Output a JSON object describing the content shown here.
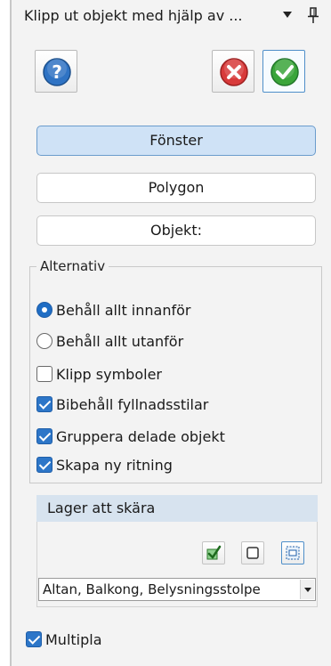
{
  "window": {
    "title": "Klipp ut objekt med hjälp av ...",
    "menu_icon": "triangle-down-icon",
    "pin_icon": "pin-icon"
  },
  "toolbar": {
    "help_icon": "help-icon",
    "cancel_icon": "cancel-icon",
    "ok_icon": "ok-icon",
    "colors": {
      "help": "#2f73c4",
      "cancel": "#d83a3a",
      "ok": "#3aa53a"
    }
  },
  "modes": {
    "window_label": "Fönster",
    "polygon_label": "Polygon",
    "object_label": "Objekt:"
  },
  "alternatives": {
    "label": "Alternativ",
    "radio_inside": {
      "label": "Behåll allt innanför",
      "checked": true
    },
    "radio_outside": {
      "label": "Behåll allt utanför",
      "checked": false
    },
    "clip_symbols": {
      "label": "Klipp symboler",
      "checked": false
    },
    "keep_fill_styles": {
      "label": "Bibehåll fyllnadsstilar",
      "checked": true
    },
    "group_shared_objects": {
      "label": "Gruppera delade objekt",
      "checked": true
    },
    "create_new_drawing": {
      "label": "Skapa ny ritning",
      "checked": true
    }
  },
  "layers": {
    "header": "Lager att skära",
    "selected_value": "Altan, Balkong, Belysningsstolpe",
    "check_all_icon": "check-all-icon",
    "uncheck_all_icon": "uncheck-all-icon",
    "select_region_icon": "select-region-icon"
  },
  "multiple": {
    "label": "Multipla",
    "checked": true
  }
}
